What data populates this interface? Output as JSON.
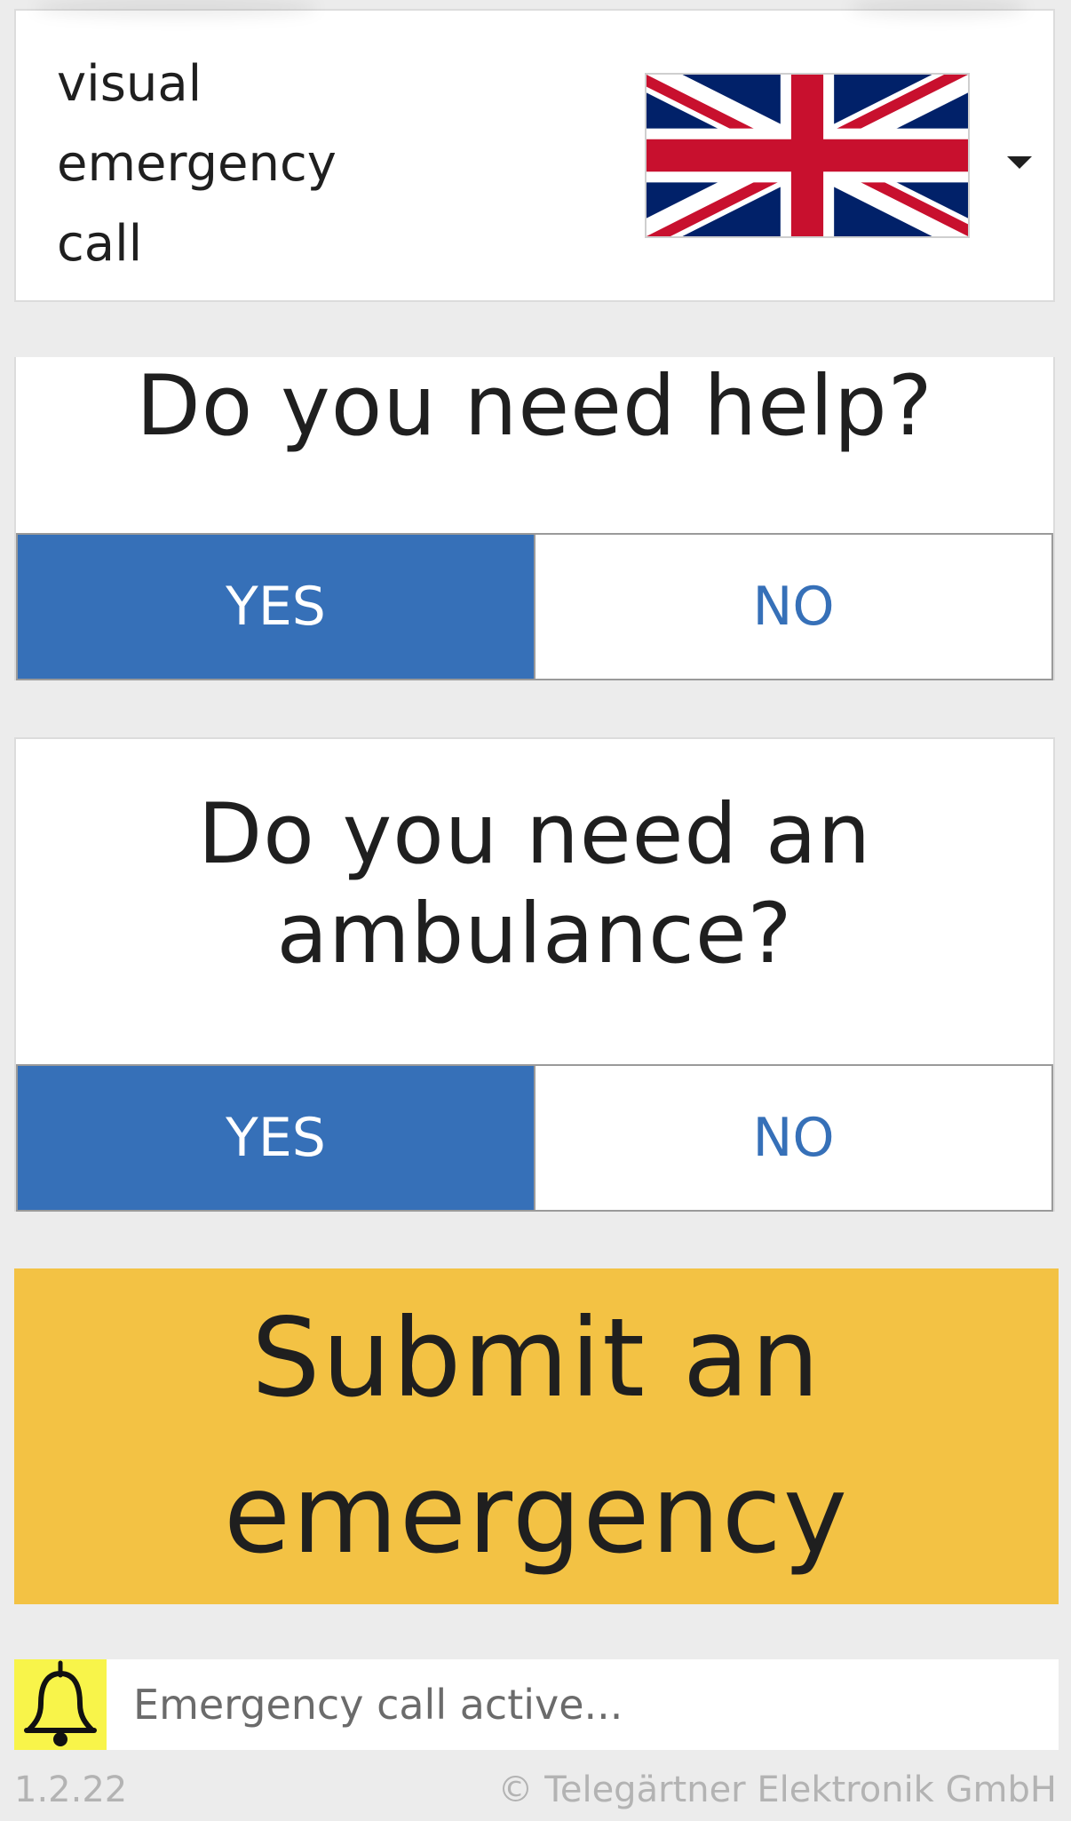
{
  "header": {
    "title": "visual emergency call",
    "language_flag": "uk-flag-icon",
    "language_dropdown_icon": "caret-down-icon"
  },
  "questions": [
    {
      "text": "Do you need help?",
      "yes_label": "YES",
      "no_label": "NO",
      "selected": "YES"
    },
    {
      "text": "Do you need an ambulance?",
      "yes_label": "YES",
      "no_label": "NO",
      "selected": "YES"
    }
  ],
  "submit": {
    "label": "Submit an emergency"
  },
  "status": {
    "icon": "bell-icon",
    "text": "Emergency call active..."
  },
  "footer": {
    "version": "1.2.22",
    "copyright": "© Telegärtner Elektronik GmbH"
  },
  "colors": {
    "accent_blue": "#3670b8",
    "submit_yellow": "#f3c244",
    "bell_yellow": "#f8f44a",
    "background": "#ececec"
  }
}
